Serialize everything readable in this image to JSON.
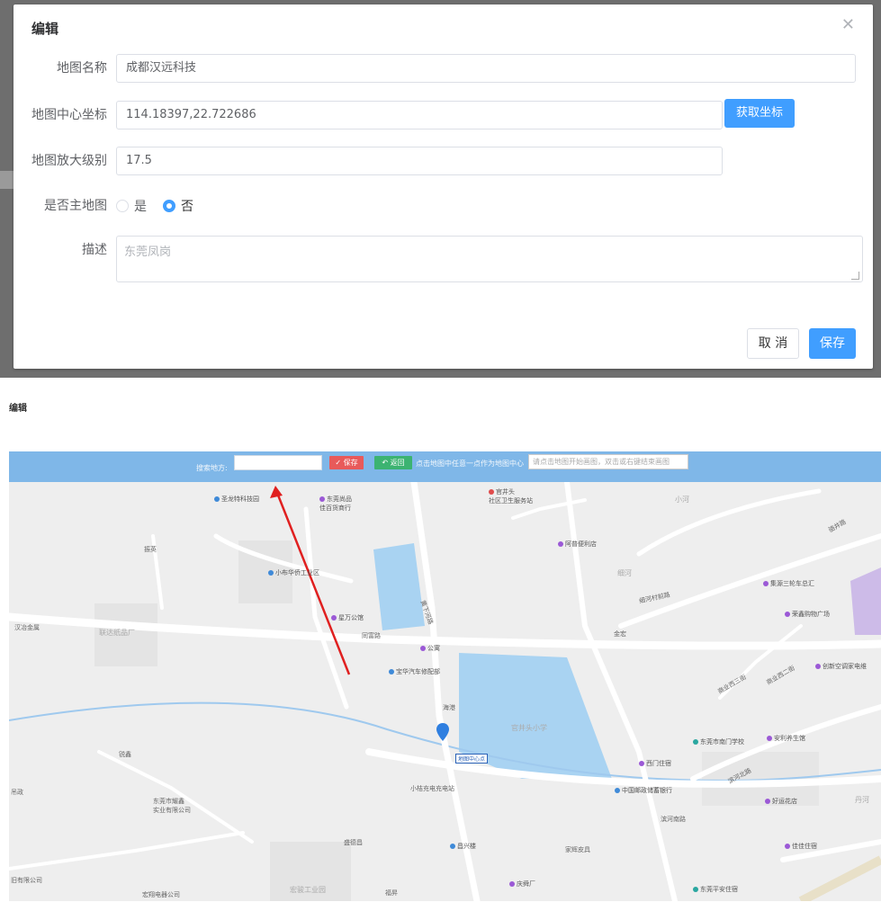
{
  "dialog": {
    "title": "编辑",
    "close_icon": "close-icon",
    "fields": {
      "map_name": {
        "label": "地图名称",
        "value": "成都汉远科技"
      },
      "center_coord": {
        "label": "地图中心坐标",
        "value": "114.18397,22.722686",
        "button": "获取坐标"
      },
      "zoom": {
        "label": "地图放大级别",
        "value": "17.5"
      },
      "is_main": {
        "label": "是否主地图",
        "options": [
          "是",
          "否"
        ],
        "selected": "否"
      },
      "description": {
        "label": "描述",
        "placeholder": "东莞凤岗"
      }
    },
    "cancel_label": "取 消",
    "save_label": "保存",
    "accent_color": "#409eff"
  },
  "editor": {
    "page_title": "编辑",
    "toolbar": {
      "search_label": "搜索地方:",
      "save_label": "✓ 保存",
      "back_label": "↶ 返回",
      "hint": "点击地图中任意一点作为地图中心",
      "draw_hint": "请点击地图开始画图，双击或右键结束画图"
    },
    "map_labels": {
      "l1": "圣龙特科技园",
      "l2": "东莞尚品\n佳百货商行",
      "l3": "官井头\n社区卫生服务站",
      "l4": "阿普便利店",
      "l5": "振英",
      "l6": "小布华侨工业区",
      "l7": "集源三轮车总汇",
      "l8": "汉冶金属",
      "l9": "联达纸品厂",
      "l10": "星万公馆",
      "l11": "同富路",
      "l12": "公寓",
      "l13": "金宏",
      "l14": "荣鑫购物广场",
      "l15": "创新空调家电维",
      "l16": "宝华汽车修配部",
      "l17": "海港",
      "l18": "官井头小学",
      "l19": "地图中心点",
      "l20": "东莞市南门学校",
      "l21": "安利养生馆",
      "l22": "锐鑫",
      "l23": "西门住宿",
      "l24": "小桔充电充电站",
      "l25": "中国邮政储蓄银行",
      "l26": "滨河北路",
      "l27": "好运花店",
      "l28": "东莞市耀鑫\n实业有限公司",
      "l29": "滨河南路",
      "l30": "盛德昌",
      "l31": "昌兴楼",
      "l32": "家辉皮具",
      "l33": "佳佳住宿",
      "l34": "宏翔电器公司",
      "l35": "宏骏工业园",
      "l36": "福昇",
      "l37": "庆舜厂",
      "l38": "东莞平安住宿",
      "l39": "商业西三街",
      "l40": "商业西二街",
      "l41": "细河",
      "l42": "细河村前路",
      "l43": "黄下河路",
      "l44": "丹河",
      "l45": "吊政",
      "l46": "旧有限公司",
      "l47": "骆井路",
      "l48": "小河"
    }
  }
}
